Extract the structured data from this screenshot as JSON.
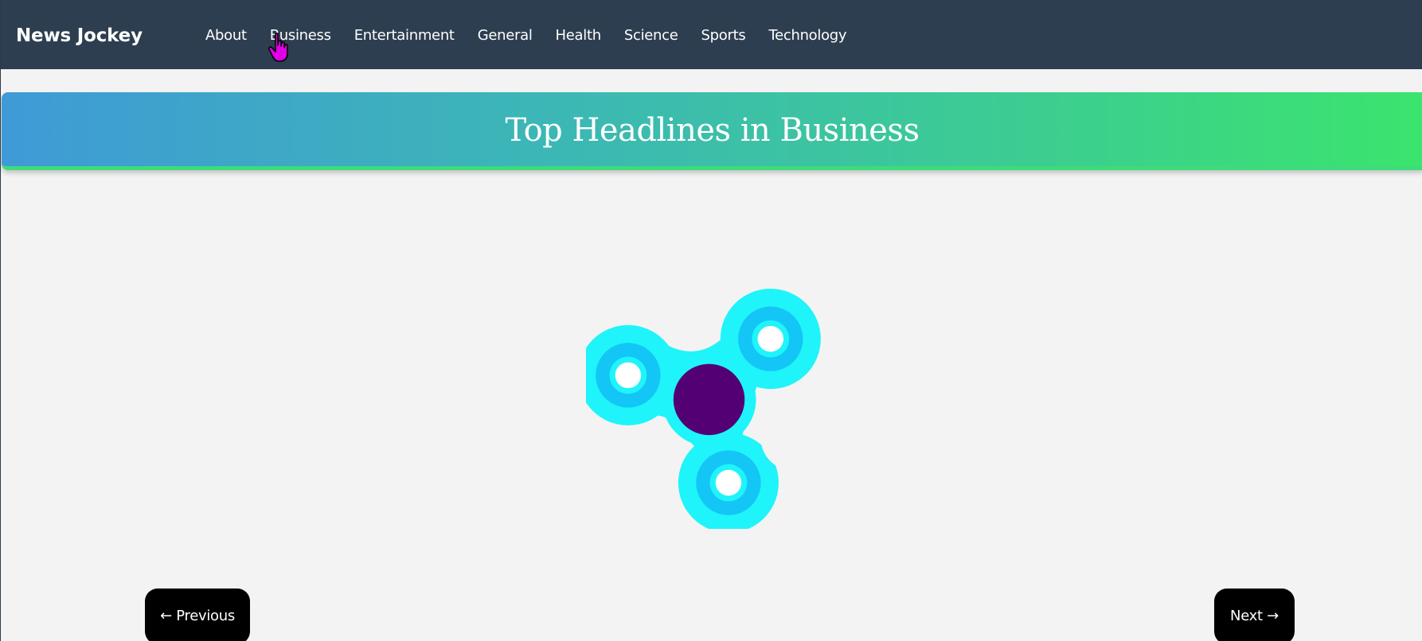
{
  "navbar": {
    "brand": "News Jockey",
    "links": [
      "About",
      "Business",
      "Entertainment",
      "General",
      "Health",
      "Science",
      "Sports",
      "Technology"
    ],
    "active": "Business"
  },
  "banner": {
    "title": "Top Headlines in Business"
  },
  "loading": {
    "icon": "fidget-spinner-icon",
    "colors": {
      "body": "#1ff4fa",
      "bearing_ring": "#13c6f5",
      "center": "#530075"
    }
  },
  "pagination": {
    "prev_label": "← Previous",
    "next_label": "Next →"
  },
  "colors": {
    "navbar_bg": "#2d3e50",
    "page_bg": "#f3f3f3",
    "banner_gradient_start": "#3f9ad6",
    "banner_gradient_end": "#3be46e",
    "button_bg": "#000000",
    "cursor": "#e000e8"
  }
}
